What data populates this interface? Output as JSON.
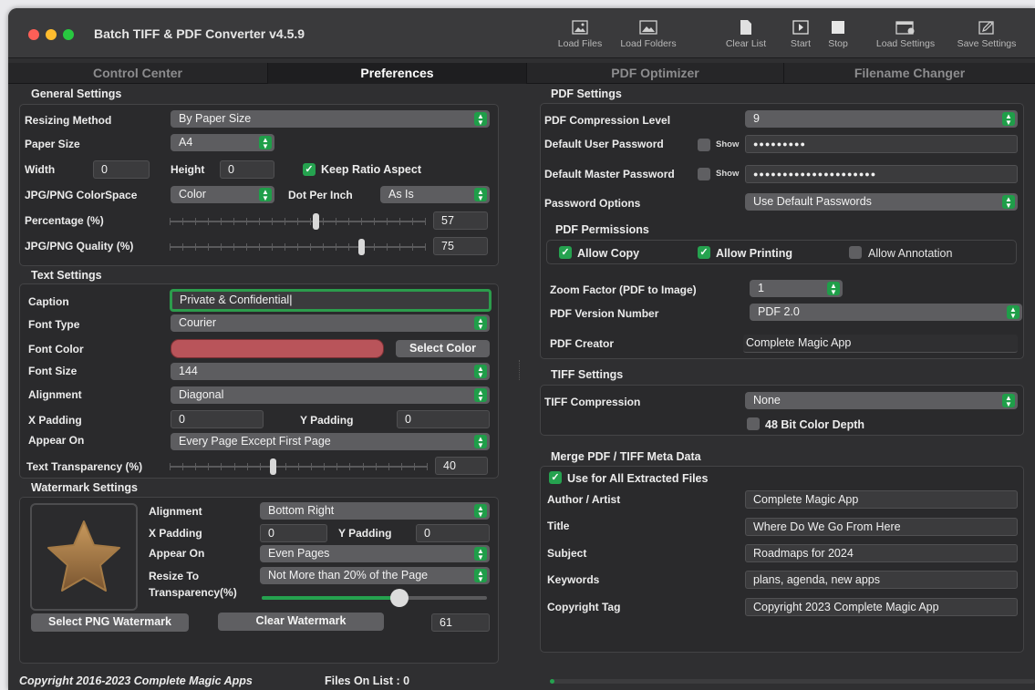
{
  "app": {
    "title": "Batch TIFF & PDF Converter v4.5.9"
  },
  "toolbar": {
    "load_files": "Load Files",
    "load_folders": "Load Folders",
    "clear_list": "Clear List",
    "start": "Start",
    "stop": "Stop",
    "load_settings": "Load Settings",
    "save_settings": "Save Settings"
  },
  "tabs": [
    "Control Center",
    "Preferences",
    "PDF Optimizer",
    "Filename Changer"
  ],
  "general": {
    "title": "General Settings",
    "resizing_method_label": "Resizing Method",
    "resizing_method": "By Paper Size",
    "paper_size_label": "Paper Size",
    "paper_size": "A4",
    "width_label": "Width",
    "width": "0",
    "height_label": "Height",
    "height": "0",
    "keep_ratio": "Keep Ratio Aspect",
    "colorspace_label": "JPG/PNG ColorSpace",
    "colorspace": "Color",
    "dpi_label": "Dot Per Inch",
    "dpi": "As Is",
    "percentage_label": "Percentage (%)",
    "percentage": "57",
    "quality_label": "JPG/PNG Quality (%)",
    "quality": "75"
  },
  "text": {
    "title": "Text Settings",
    "caption_label": "Caption",
    "caption": "Private & Confidential",
    "font_type_label": "Font Type",
    "font_type": "Courier",
    "font_color_label": "Font Color",
    "font_color": "#b9545a",
    "select_color": "Select Color",
    "font_size_label": "Font Size",
    "font_size": "144",
    "alignment_label": "Alignment",
    "alignment": "Diagonal",
    "xpad_label": "X Padding",
    "xpad": "0",
    "ypad_label": "Y Padding",
    "ypad": "0",
    "appear_label": "Appear On",
    "appear": "Every Page Except First Page",
    "transparency_label": "Text Transparency (%)",
    "transparency": "40"
  },
  "watermark": {
    "title": "Watermark Settings",
    "alignment_label": "Alignment",
    "alignment": "Bottom Right",
    "xpad_label": "X Padding",
    "xpad": "0",
    "ypad_label": "Y Padding",
    "ypad": "0",
    "appear_label": "Appear On",
    "appear": "Even Pages",
    "resize_label": "Resize To",
    "resize": "Not More than 20% of the Page",
    "transparency_label": "Transparency(%)",
    "transparency": "61",
    "select_png": "Select PNG Watermark",
    "clear": "Clear Watermark"
  },
  "pdf": {
    "title": "PDF Settings",
    "compression_label": "PDF Compression Level",
    "compression": "9",
    "user_pw_label": "Default User Password",
    "user_pw": "●●●●●●●●●",
    "master_pw_label": "Default Master Password",
    "master_pw": "●●●●●●●●●●●●●●●●●●●●●",
    "show": "Show",
    "pw_options_label": "Password Options",
    "pw_options": "Use Default Passwords",
    "permissions_title": "PDF Permissions",
    "allow_copy": "Allow Copy",
    "allow_printing": "Allow Printing",
    "allow_annotation": "Allow Annotation",
    "zoom_label": "Zoom Factor (PDF to Image)",
    "zoom": "1",
    "version_label": "PDF Version Number",
    "version": "PDF 2.0",
    "creator_label": "PDF Creator",
    "creator": "Complete Magic App"
  },
  "tiff": {
    "title": "TIFF Settings",
    "compression_label": "TIFF Compression",
    "compression": "None",
    "color_depth": "48 Bit Color Depth"
  },
  "meta": {
    "title": "Merge PDF / TIFF Meta Data",
    "use_all": "Use for All Extracted Files",
    "author_label": "Author / Artist",
    "author": "Complete Magic App",
    "title_label": "Title",
    "title_value": "Where Do We Go From Here",
    "subject_label": "Subject",
    "subject": "Roadmaps for 2024",
    "keywords_label": "Keywords",
    "keywords": "plans, agenda, new apps",
    "copyright_label": "Copyright Tag",
    "copyright": "Copyright 2023 Complete Magic App"
  },
  "status": {
    "copyright": "Copyright 2016-2023 Complete Magic Apps",
    "files": "Files On List : 0",
    "progress": 0.01
  },
  "colors": {
    "accent": "#25a24f",
    "close": "#fe5f57",
    "minimize": "#febc2e",
    "zoom": "#28c840"
  }
}
